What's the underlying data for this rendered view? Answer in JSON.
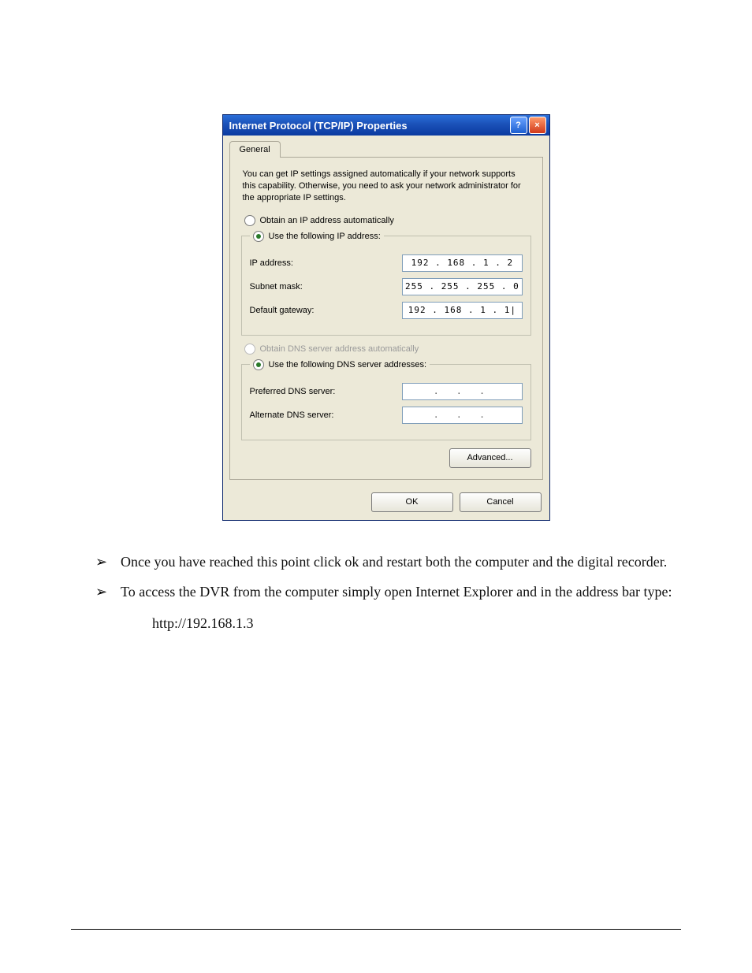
{
  "dialog": {
    "title": "Internet Protocol (TCP/IP) Properties",
    "help_glyph": "?",
    "close_glyph": "×",
    "tab_label": "General",
    "description": "You can get IP settings assigned automatically if your network supports this capability. Otherwise, you need to ask your network administrator for the appropriate IP settings.",
    "ip_section": {
      "radio_auto": "Obtain an IP address automatically",
      "radio_manual": "Use the following IP address:",
      "fields": {
        "ip_label": "IP address:",
        "ip_value": "192 . 168 .  1  .  2",
        "mask_label": "Subnet mask:",
        "mask_value": "255 . 255 . 255 .  0",
        "gw_label": "Default gateway:",
        "gw_value": "192 . 168 .  1  .  1|"
      }
    },
    "dns_section": {
      "radio_auto": "Obtain DNS server address automatically",
      "radio_manual": "Use the following DNS server addresses:",
      "fields": {
        "pref_label": "Preferred DNS server:",
        "pref_value": ".   .   .",
        "alt_label": "Alternate DNS server:",
        "alt_value": ".   .   ."
      }
    },
    "advanced_btn": "Advanced...",
    "ok_btn": "OK",
    "cancel_btn": "Cancel"
  },
  "instructions": {
    "item1": "Once you have reached this point click ok and restart both the computer and the digital recorder.",
    "item2": "To access the DVR from the computer simply open Internet Explorer and in the address bar type:",
    "url": "http://192.168.1.3"
  }
}
